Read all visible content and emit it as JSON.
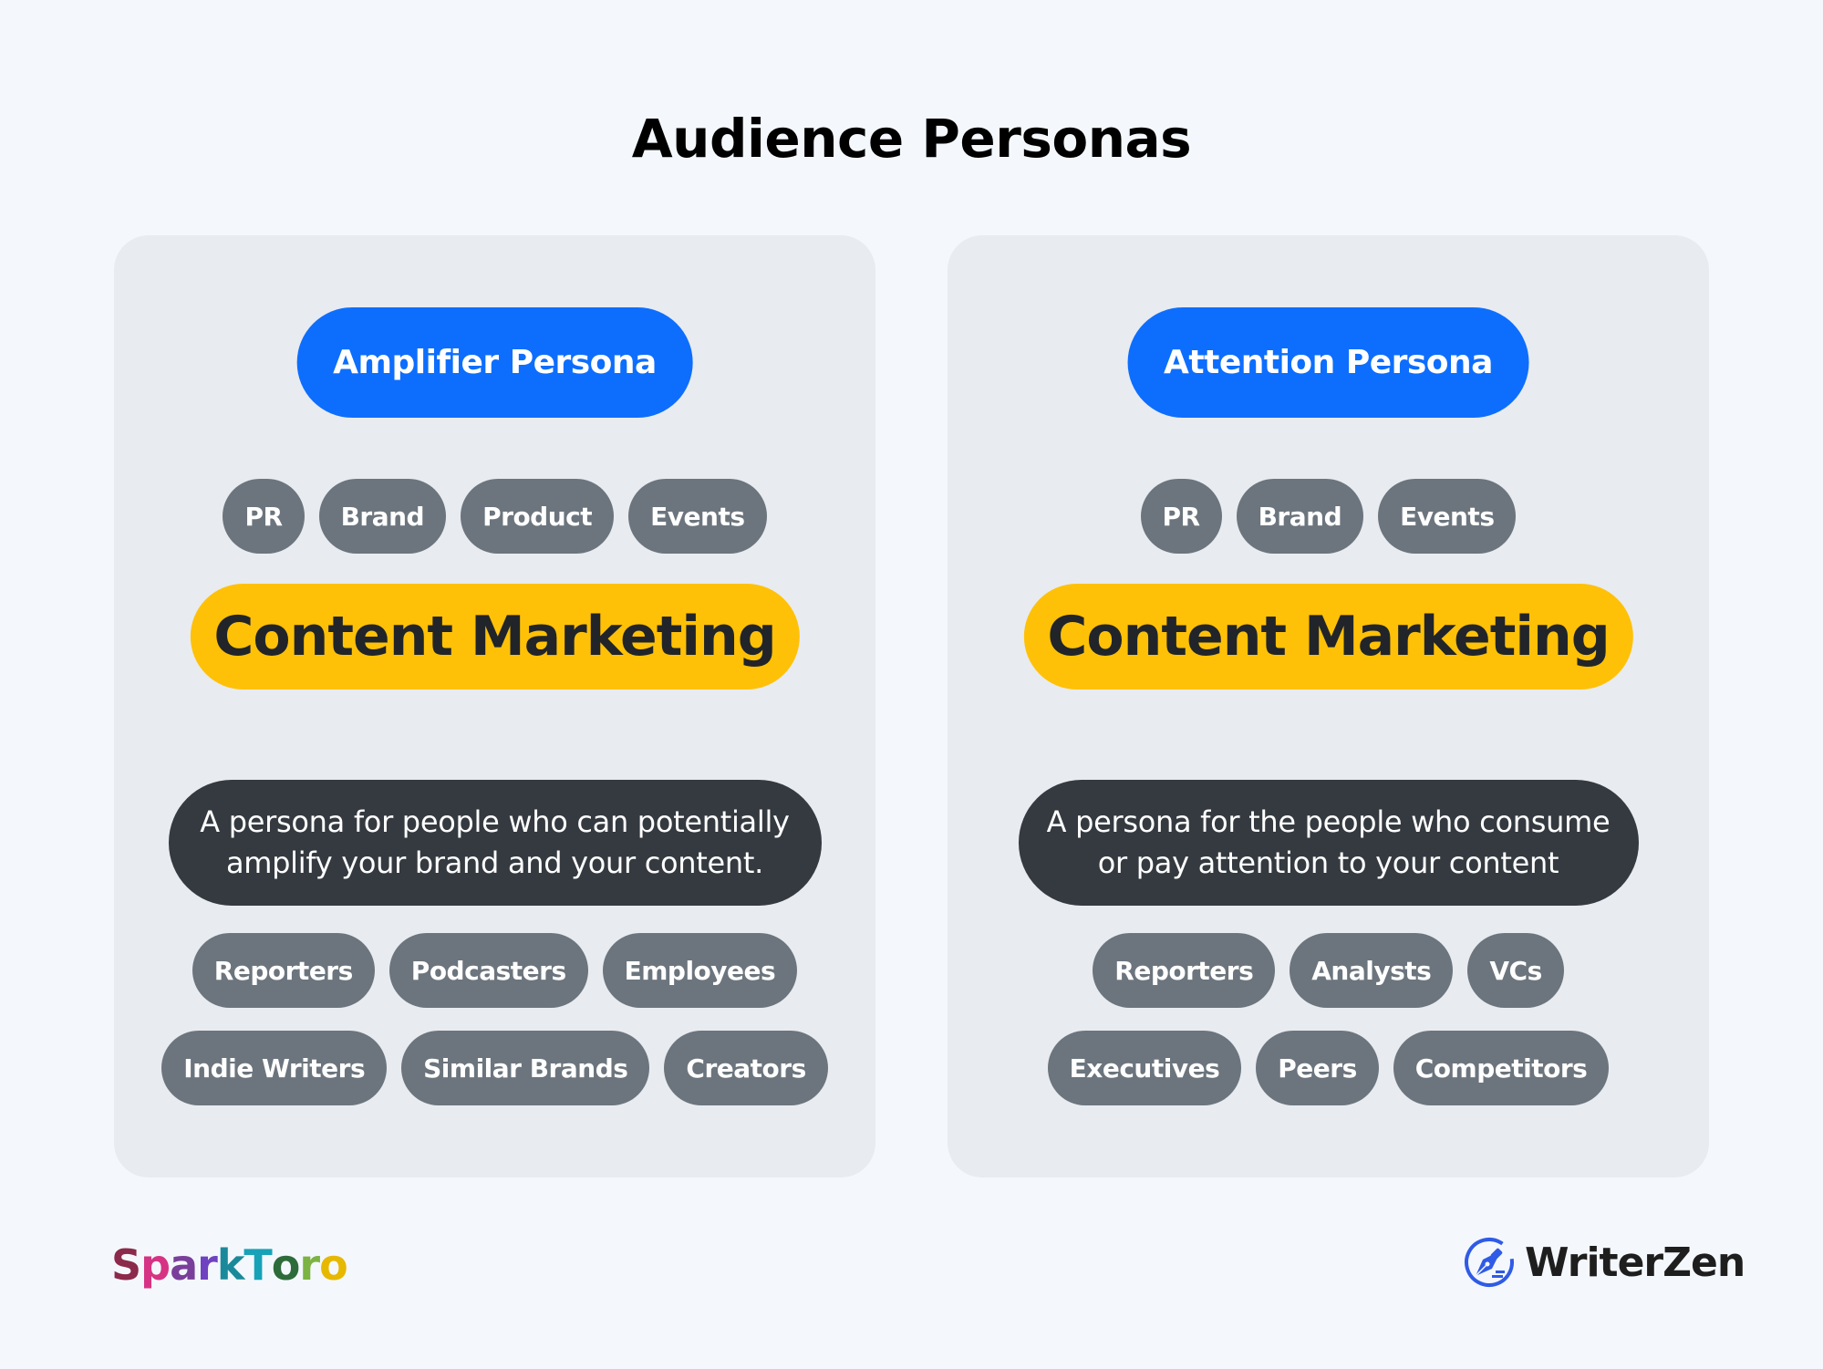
{
  "title": "Audience Personas",
  "colors": {
    "background": "#f4f8fd",
    "card": "#e8ebf0",
    "persona_pill": "#0d6efd",
    "tag": "#6c757d",
    "content_marketing": "#ffc107",
    "description": "#343a40"
  },
  "personas": [
    {
      "name": "Amplifier Persona",
      "top_tags": [
        "PR",
        "Brand",
        "Product",
        "Events"
      ],
      "focus": "Content Marketing",
      "description_lines": [
        "A persona for people who can potentially",
        "amplify your brand and your content."
      ],
      "audience_rows": [
        [
          "Reporters",
          "Podcasters",
          "Employees"
        ],
        [
          "Indie Writers",
          "Similar Brands",
          "Creators"
        ]
      ]
    },
    {
      "name": "Attention Persona",
      "top_tags": [
        "PR",
        "Brand",
        "Events"
      ],
      "focus": "Content Marketing",
      "description_lines": [
        "A persona for the people who consume",
        "or pay attention to your content"
      ],
      "audience_rows": [
        [
          "Reporters",
          "Analysts",
          "VCs"
        ],
        [
          "Executives",
          "Peers",
          "Competitors"
        ]
      ]
    }
  ],
  "logos": {
    "left": {
      "name": "sparktoro-logo",
      "letters": [
        "S",
        "p",
        "a",
        "r",
        "k",
        "T",
        "o",
        "r",
        "o"
      ],
      "colors": [
        "#8b2a4a",
        "#d63384",
        "#7a3f9a",
        "#6f42c1",
        "#1a8a9a",
        "#17a2b8",
        "#2e6b3a",
        "#7cb342",
        "#e6b800"
      ]
    },
    "right": {
      "name": "writerzen-logo",
      "text": "WriterZen",
      "icon_color": "#2f5be6"
    }
  }
}
